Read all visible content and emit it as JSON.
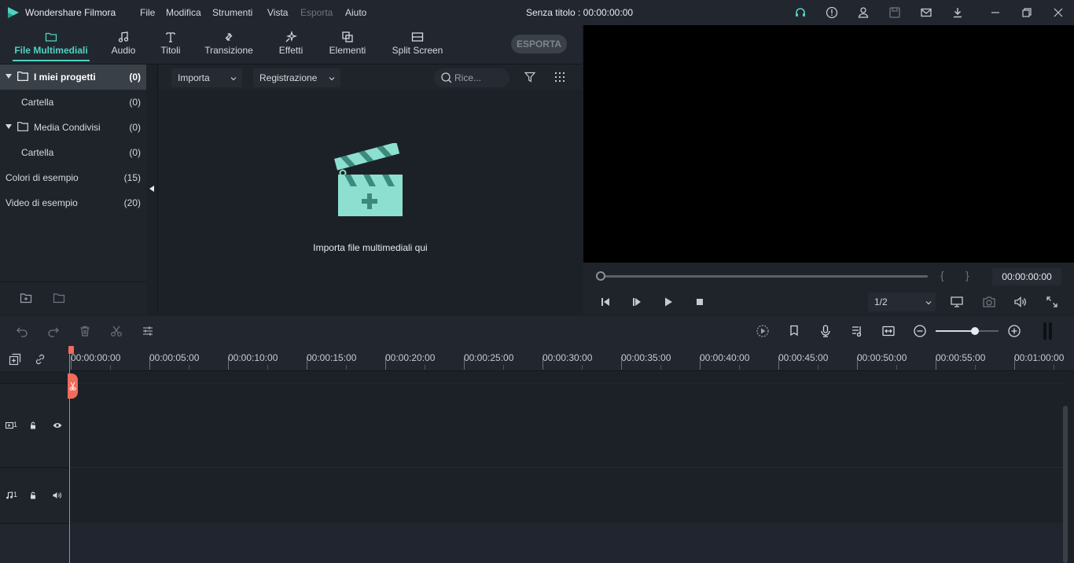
{
  "app": {
    "name": "Wondershare Filmora",
    "doc_title": "Senza titolo : 00:00:00:00"
  },
  "menu": [
    "File",
    "Modifica",
    "Strumenti",
    "Vista",
    "Esporta",
    "Aiuto"
  ],
  "menu_disabled": [
    "Esporta"
  ],
  "titlebar_icons": [
    "headset-icon",
    "info-icon",
    "user-icon",
    "save-icon",
    "mail-icon",
    "download-icon",
    "minimize-icon",
    "restore-icon",
    "close-icon"
  ],
  "media_tabs": [
    {
      "label": "File Multimediali",
      "icon": "folder-icon",
      "active": true
    },
    {
      "label": "Audio",
      "icon": "music-note-icon",
      "active": false
    },
    {
      "label": "Titoli",
      "icon": "text-icon",
      "active": false
    },
    {
      "label": "Transizione",
      "icon": "transition-icon",
      "active": false
    },
    {
      "label": "Effetti",
      "icon": "effects-icon",
      "active": false
    },
    {
      "label": "Elementi",
      "icon": "elements-icon",
      "active": false
    },
    {
      "label": "Split Screen",
      "icon": "split-screen-icon",
      "active": false
    }
  ],
  "export_button": "ESPORTA",
  "library": [
    {
      "name": "I miei progetti",
      "count": "(0)",
      "selected": true
    },
    {
      "name": "Cartella",
      "count": "(0)"
    },
    {
      "name": "Media Condivisi",
      "count": "(0)"
    },
    {
      "name": "Cartella",
      "count": "(0)"
    },
    {
      "name": "Colori di esempio",
      "count": "(15)"
    },
    {
      "name": "Video di esempio",
      "count": "(20)"
    }
  ],
  "media_toolbar": {
    "import_label": "Importa",
    "record_label": "Registrazione",
    "search_placeholder": "Rice..."
  },
  "drop_hint": "Importa file multimediali qui",
  "preview": {
    "timecode": "00:00:00:00",
    "in_mark": "{",
    "out_mark": "}",
    "quality": "1/2"
  },
  "timeline": {
    "ruler_labels": [
      "00:00:00:00",
      "00:00:05:00",
      "00:00:10:00",
      "00:00:15:00",
      "00:00:20:00",
      "00:00:25:00",
      "00:00:30:00",
      "00:00:35:00",
      "00:00:40:00",
      "00:00:45:00",
      "00:00:50:00",
      "00:00:55:00",
      "00:01:00:00"
    ],
    "video_track_label": "1",
    "audio_track_label": "1",
    "zoom_level": 0.62
  },
  "colors": {
    "accent": "#4fd3c4",
    "playhead": "#f26b5b",
    "background": "#1c2128"
  }
}
